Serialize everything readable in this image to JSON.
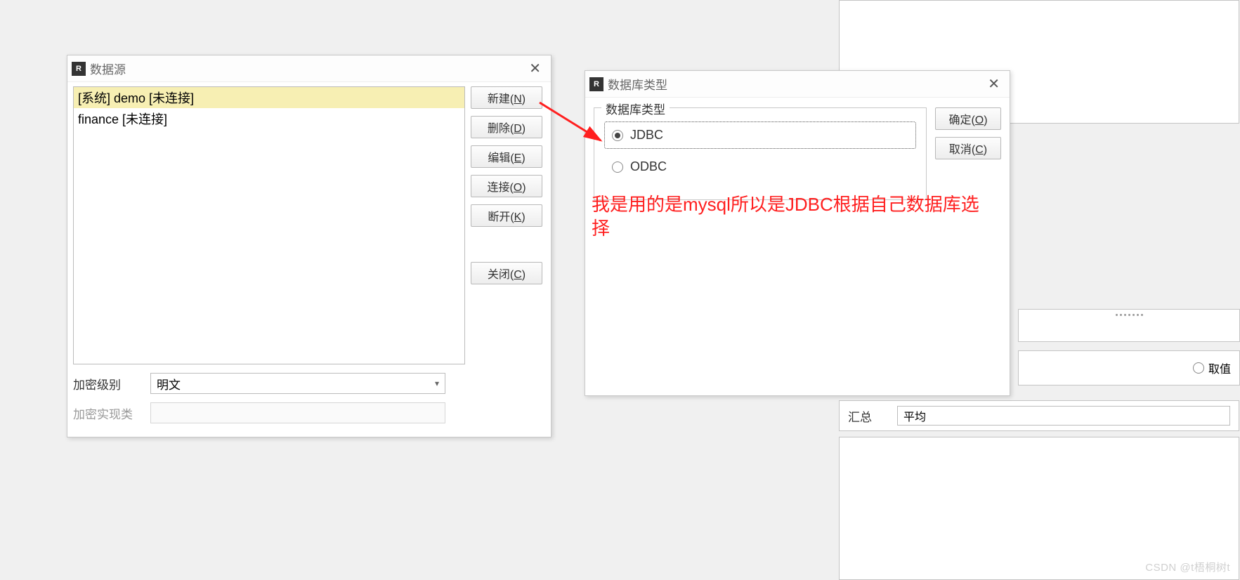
{
  "dialog1": {
    "title": "数据源",
    "list_items": [
      {
        "text": "[系统] demo [未连接]",
        "selected": true
      },
      {
        "text": "finance [未连接]",
        "selected": false
      }
    ],
    "buttons": {
      "new": {
        "pre": "新建(",
        "u": "N",
        "post": ")"
      },
      "delete": {
        "pre": "删除(",
        "u": "D",
        "post": ")"
      },
      "edit": {
        "pre": "编辑(",
        "u": "E",
        "post": ")"
      },
      "connect": {
        "pre": "连接(",
        "u": "O",
        "post": ")"
      },
      "disconnect": {
        "pre": "断开(",
        "u": "K",
        "post": ")"
      },
      "close": {
        "pre": "关闭(",
        "u": "C",
        "post": ")"
      }
    },
    "encrypt_level_label": "加密级别",
    "encrypt_level_value": "明文",
    "encrypt_impl_label": "加密实现类"
  },
  "dialog2": {
    "title": "数据库类型",
    "legend": "数据库类型",
    "radios": {
      "jdbc": {
        "label": "JDBC",
        "checked": true
      },
      "odbc": {
        "label": "ODBC",
        "checked": false
      }
    },
    "ok": {
      "pre": "确定(",
      "u": "O",
      "post": ")"
    },
    "cancel": {
      "pre": "取消(",
      "u": "C",
      "post": ")"
    }
  },
  "annotation": "我是用的是mysql所以是JDBC根据自己数据库选择",
  "bg": {
    "getval_label": "取值",
    "summary_label": "汇总",
    "summary_value": "平均"
  },
  "watermark": "CSDN @t梧桐树t"
}
